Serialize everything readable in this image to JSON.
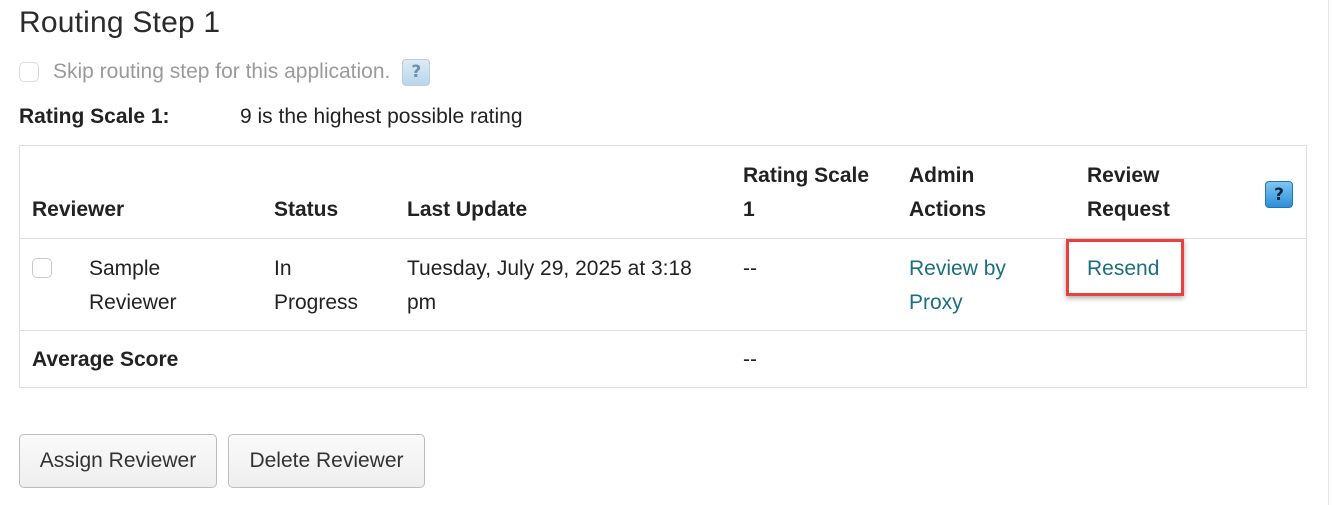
{
  "title": "Routing Step 1",
  "skip": {
    "label": "Skip routing step for this application.",
    "checked": false,
    "help_icon": "question-icon"
  },
  "rating_scale": {
    "label": "Rating Scale 1:",
    "value": "9 is the highest possible rating"
  },
  "table": {
    "headers": {
      "reviewer": "Reviewer",
      "status": "Status",
      "last_update": "Last Update",
      "rating_line1": "Rating Scale",
      "rating_line2": "1",
      "admin_line1": "Admin",
      "admin_line2": "Actions",
      "request_line1": "Review",
      "request_line2": "Request",
      "help_icon": "question-icon"
    },
    "rows": [
      {
        "reviewer_line1": "Sample",
        "reviewer_line2": "Reviewer",
        "status_line1": "In",
        "status_line2": "Progress",
        "last_update_line1": "Tuesday, July 29, 2025 at 3:18",
        "last_update_line2": "pm",
        "rating": "--",
        "admin_line1": "Review by",
        "admin_line2": "Proxy",
        "request": "Resend"
      }
    ],
    "average": {
      "label": "Average Score",
      "value": "--"
    }
  },
  "buttons": {
    "assign": "Assign Reviewer",
    "delete": "Delete Reviewer"
  },
  "colors": {
    "link": "#1a6f80",
    "highlight": "#e8403d"
  }
}
